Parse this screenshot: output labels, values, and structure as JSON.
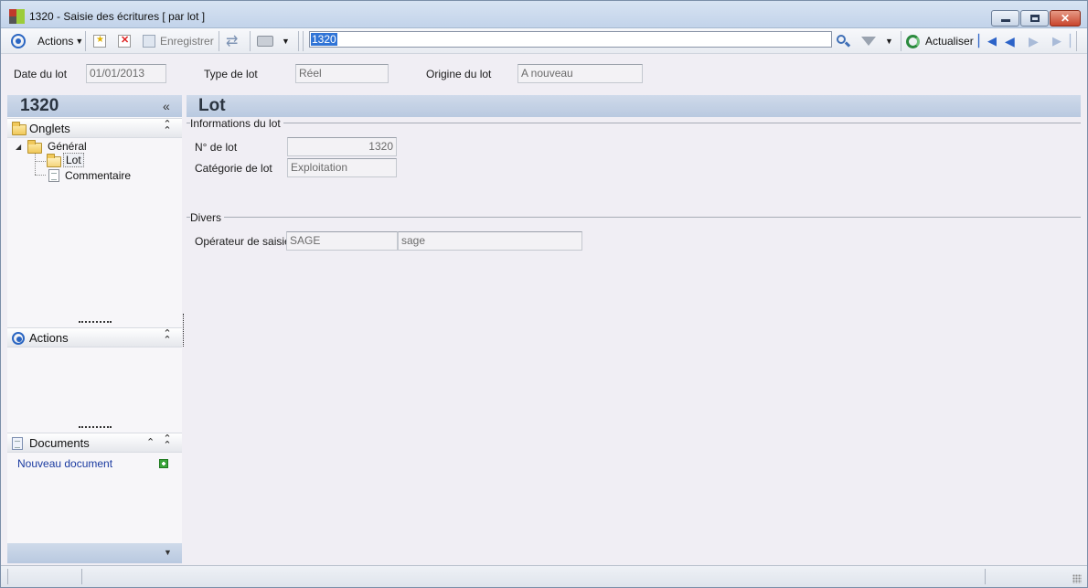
{
  "window": {
    "title": "1320 -  Saisie des écritures [ par lot ]"
  },
  "toolbar": {
    "actions_label": "Actions",
    "save_label": "Enregistrer",
    "search_value": "1320",
    "refresh_label": "Actualiser"
  },
  "header": {
    "date_label": "Date du lot",
    "date_value": "01/01/2013",
    "type_label": "Type de lot",
    "type_value": "Réel",
    "origin_label": "Origine du lot",
    "origin_value": "A nouveau"
  },
  "left_panel": {
    "title": "1320",
    "tabs_section": "Onglets",
    "tree": {
      "root": "Général",
      "children": [
        "Lot",
        "Commentaire"
      ]
    },
    "actions_section": "Actions",
    "documents_section": "Documents",
    "new_document_link": "Nouveau document"
  },
  "main": {
    "title": "Lot",
    "group1": "Informations du lot",
    "lot_number_label": "N° de lot",
    "lot_number_value": "1320",
    "category_label": "Catégorie de lot",
    "category_value": "Exploitation",
    "group2": "Divers",
    "operator_label": "Opérateur de saisie",
    "operator_code": "SAGE",
    "operator_name": "sage"
  },
  "colors": {
    "accent": "#2b66c2",
    "selection": "#3074d6",
    "panel_header": "#c4d2e6"
  }
}
